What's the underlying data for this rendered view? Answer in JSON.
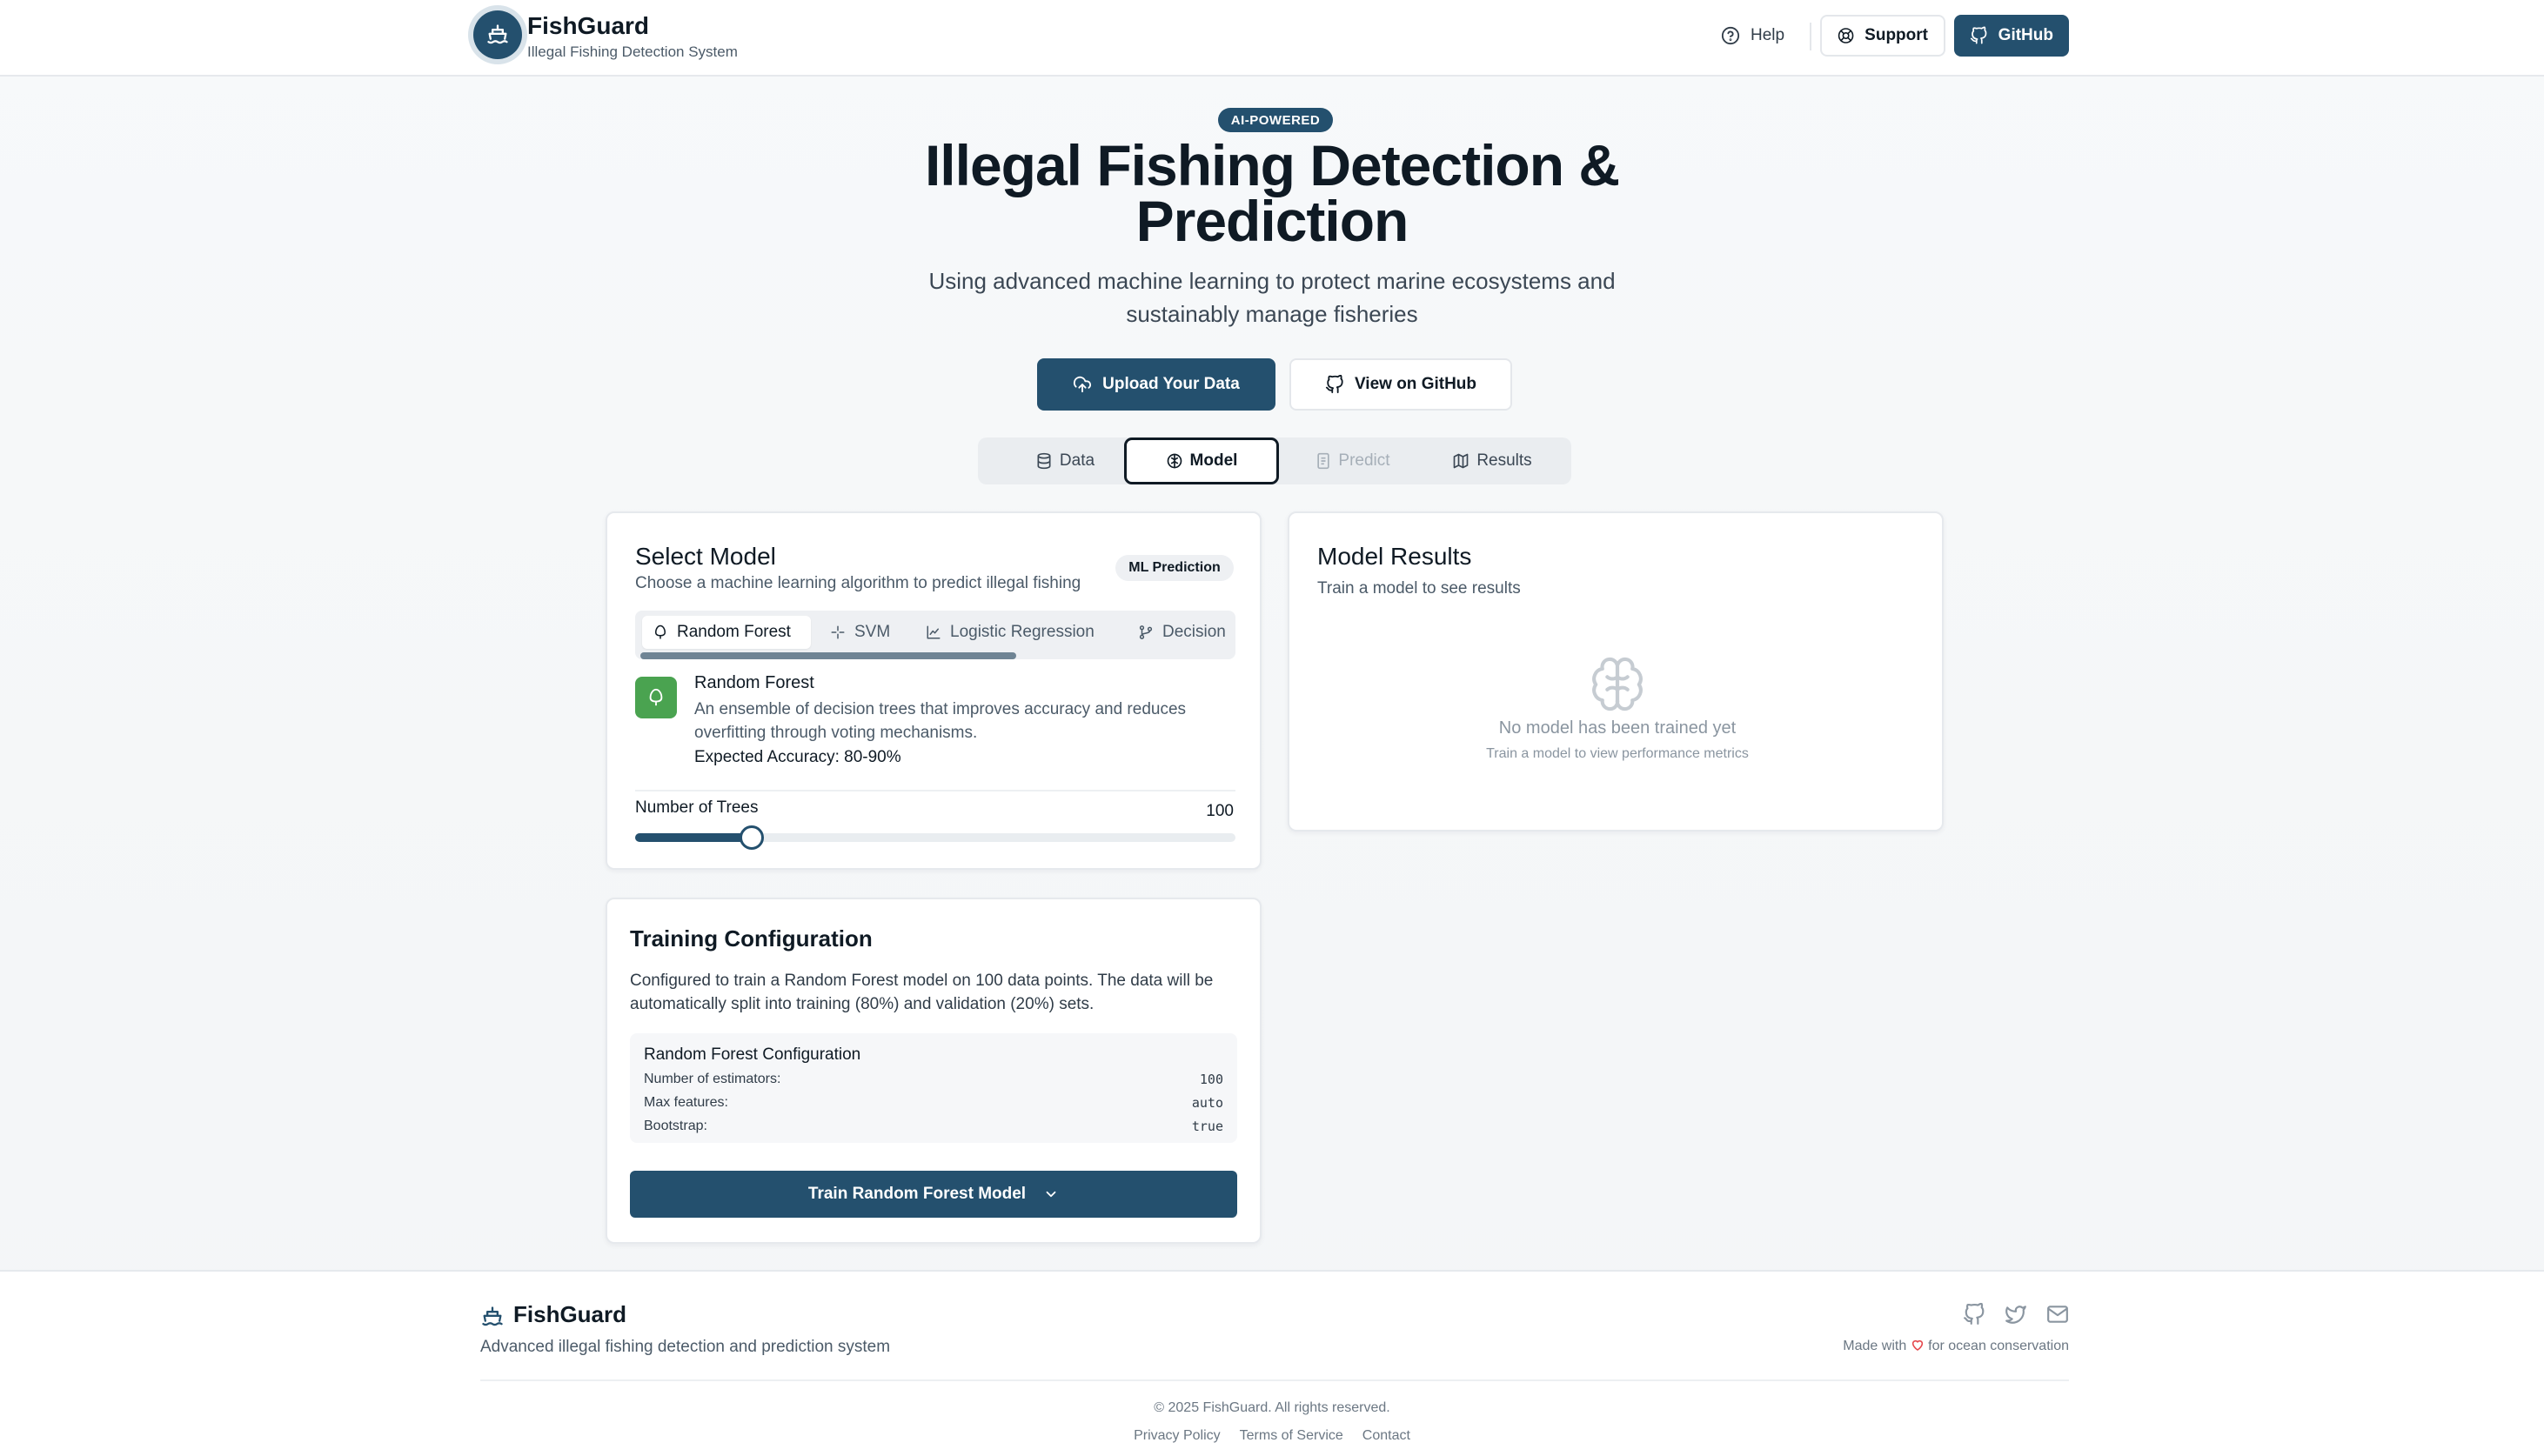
{
  "header": {
    "brand": "FishGuard",
    "subtitle": "Illegal Fishing Detection System",
    "help_label": "Help",
    "support_label": "Support",
    "github_label": "GitHub"
  },
  "hero": {
    "badge": "AI-POWERED",
    "title": "Illegal Fishing Detection & Prediction",
    "subtitle": "Using advanced machine learning to protect marine ecosystems and sustainably manage fisheries",
    "upload_label": "Upload Your Data",
    "github_view_label": "View on GitHub"
  },
  "tabs": [
    {
      "label": "Data",
      "icon": "database-icon",
      "state": "normal"
    },
    {
      "label": "Model",
      "icon": "brain-icon",
      "state": "active"
    },
    {
      "label": "Predict",
      "icon": "document-icon",
      "state": "disabled"
    },
    {
      "label": "Results",
      "icon": "map-icon",
      "state": "normal"
    }
  ],
  "select_model": {
    "title": "Select Model",
    "description": "Choose a machine learning algorithm to predict illegal fishing",
    "badge": "ML Prediction",
    "model_tabs": [
      {
        "label": "Random Forest",
        "icon": "tree-icon",
        "selected": true
      },
      {
        "label": "SVM",
        "icon": "sparkle-icon",
        "selected": false
      },
      {
        "label": "Logistic Regression",
        "icon": "chart-line-icon",
        "selected": false
      },
      {
        "label": "Decision",
        "icon": "git-branch-icon",
        "selected": false
      }
    ],
    "selected": {
      "name": "Random Forest",
      "description": "An ensemble of decision trees that improves accuracy and reduces overfitting through voting mechanisms.",
      "accuracy": "Expected Accuracy: 80-90%"
    },
    "param": {
      "label": "Number of Trees",
      "value": "100",
      "fraction": 0.2
    }
  },
  "model_results": {
    "title": "Model Results",
    "description": "Train a model to see results",
    "empty_title": "No model has been trained yet",
    "empty_sub": "Train a model to view performance metrics"
  },
  "training": {
    "title": "Training Configuration",
    "description": "Configured to train a Random Forest model on 100 data points. The data will be automatically split into training (80%) and validation (20%) sets.",
    "config_title": "Random Forest Configuration",
    "config": [
      {
        "key": "Number of estimators:",
        "value": "100"
      },
      {
        "key": "Max features:",
        "value": "auto"
      },
      {
        "key": "Bootstrap:",
        "value": "true"
      }
    ],
    "train_label": "Train Random Forest Model"
  },
  "footer": {
    "brand": "FishGuard",
    "tagline": "Advanced illegal fishing detection and prediction system",
    "made_prefix": "Made with",
    "made_suffix": "for ocean conservation",
    "copyright": "© 2025 FishGuard. All rights reserved.",
    "links": [
      "Privacy Policy",
      "Terms of Service",
      "Contact"
    ]
  },
  "colors": {
    "primary": "#24506e",
    "accent_green": "#4aa350",
    "heart": "#e5484d"
  }
}
